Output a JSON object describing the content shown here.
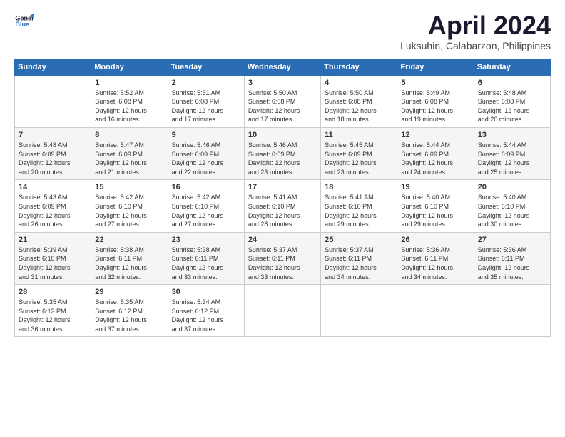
{
  "logo": {
    "line1": "General",
    "line2": "Blue",
    "icon_color": "#2a6db5"
  },
  "title": "April 2024",
  "subtitle": "Luksuhin, Calabarzon, Philippines",
  "header": {
    "accent_color": "#2a6db5"
  },
  "weekdays": [
    "Sunday",
    "Monday",
    "Tuesday",
    "Wednesday",
    "Thursday",
    "Friday",
    "Saturday"
  ],
  "weeks": [
    [
      {
        "day": "",
        "info": ""
      },
      {
        "day": "1",
        "info": "Sunrise: 5:52 AM\nSunset: 6:08 PM\nDaylight: 12 hours\nand 16 minutes."
      },
      {
        "day": "2",
        "info": "Sunrise: 5:51 AM\nSunset: 6:08 PM\nDaylight: 12 hours\nand 17 minutes."
      },
      {
        "day": "3",
        "info": "Sunrise: 5:50 AM\nSunset: 6:08 PM\nDaylight: 12 hours\nand 17 minutes."
      },
      {
        "day": "4",
        "info": "Sunrise: 5:50 AM\nSunset: 6:08 PM\nDaylight: 12 hours\nand 18 minutes."
      },
      {
        "day": "5",
        "info": "Sunrise: 5:49 AM\nSunset: 6:08 PM\nDaylight: 12 hours\nand 19 minutes."
      },
      {
        "day": "6",
        "info": "Sunrise: 5:48 AM\nSunset: 6:08 PM\nDaylight: 12 hours\nand 20 minutes."
      }
    ],
    [
      {
        "day": "7",
        "info": "Sunrise: 5:48 AM\nSunset: 6:09 PM\nDaylight: 12 hours\nand 20 minutes."
      },
      {
        "day": "8",
        "info": "Sunrise: 5:47 AM\nSunset: 6:09 PM\nDaylight: 12 hours\nand 21 minutes."
      },
      {
        "day": "9",
        "info": "Sunrise: 5:46 AM\nSunset: 6:09 PM\nDaylight: 12 hours\nand 22 minutes."
      },
      {
        "day": "10",
        "info": "Sunrise: 5:46 AM\nSunset: 6:09 PM\nDaylight: 12 hours\nand 23 minutes."
      },
      {
        "day": "11",
        "info": "Sunrise: 5:45 AM\nSunset: 6:09 PM\nDaylight: 12 hours\nand 23 minutes."
      },
      {
        "day": "12",
        "info": "Sunrise: 5:44 AM\nSunset: 6:09 PM\nDaylight: 12 hours\nand 24 minutes."
      },
      {
        "day": "13",
        "info": "Sunrise: 5:44 AM\nSunset: 6:09 PM\nDaylight: 12 hours\nand 25 minutes."
      }
    ],
    [
      {
        "day": "14",
        "info": "Sunrise: 5:43 AM\nSunset: 6:09 PM\nDaylight: 12 hours\nand 26 minutes."
      },
      {
        "day": "15",
        "info": "Sunrise: 5:42 AM\nSunset: 6:10 PM\nDaylight: 12 hours\nand 27 minutes."
      },
      {
        "day": "16",
        "info": "Sunrise: 5:42 AM\nSunset: 6:10 PM\nDaylight: 12 hours\nand 27 minutes."
      },
      {
        "day": "17",
        "info": "Sunrise: 5:41 AM\nSunset: 6:10 PM\nDaylight: 12 hours\nand 28 minutes."
      },
      {
        "day": "18",
        "info": "Sunrise: 5:41 AM\nSunset: 6:10 PM\nDaylight: 12 hours\nand 29 minutes."
      },
      {
        "day": "19",
        "info": "Sunrise: 5:40 AM\nSunset: 6:10 PM\nDaylight: 12 hours\nand 29 minutes."
      },
      {
        "day": "20",
        "info": "Sunrise: 5:40 AM\nSunset: 6:10 PM\nDaylight: 12 hours\nand 30 minutes."
      }
    ],
    [
      {
        "day": "21",
        "info": "Sunrise: 5:39 AM\nSunset: 6:10 PM\nDaylight: 12 hours\nand 31 minutes."
      },
      {
        "day": "22",
        "info": "Sunrise: 5:38 AM\nSunset: 6:11 PM\nDaylight: 12 hours\nand 32 minutes."
      },
      {
        "day": "23",
        "info": "Sunrise: 5:38 AM\nSunset: 6:11 PM\nDaylight: 12 hours\nand 33 minutes."
      },
      {
        "day": "24",
        "info": "Sunrise: 5:37 AM\nSunset: 6:11 PM\nDaylight: 12 hours\nand 33 minutes."
      },
      {
        "day": "25",
        "info": "Sunrise: 5:37 AM\nSunset: 6:11 PM\nDaylight: 12 hours\nand 34 minutes."
      },
      {
        "day": "26",
        "info": "Sunrise: 5:36 AM\nSunset: 6:11 PM\nDaylight: 12 hours\nand 34 minutes."
      },
      {
        "day": "27",
        "info": "Sunrise: 5:36 AM\nSunset: 6:11 PM\nDaylight: 12 hours\nand 35 minutes."
      }
    ],
    [
      {
        "day": "28",
        "info": "Sunrise: 5:35 AM\nSunset: 6:12 PM\nDaylight: 12 hours\nand 36 minutes."
      },
      {
        "day": "29",
        "info": "Sunrise: 5:35 AM\nSunset: 6:12 PM\nDaylight: 12 hours\nand 37 minutes."
      },
      {
        "day": "30",
        "info": "Sunrise: 5:34 AM\nSunset: 6:12 PM\nDaylight: 12 hours\nand 37 minutes."
      },
      {
        "day": "",
        "info": ""
      },
      {
        "day": "",
        "info": ""
      },
      {
        "day": "",
        "info": ""
      },
      {
        "day": "",
        "info": ""
      }
    ]
  ]
}
